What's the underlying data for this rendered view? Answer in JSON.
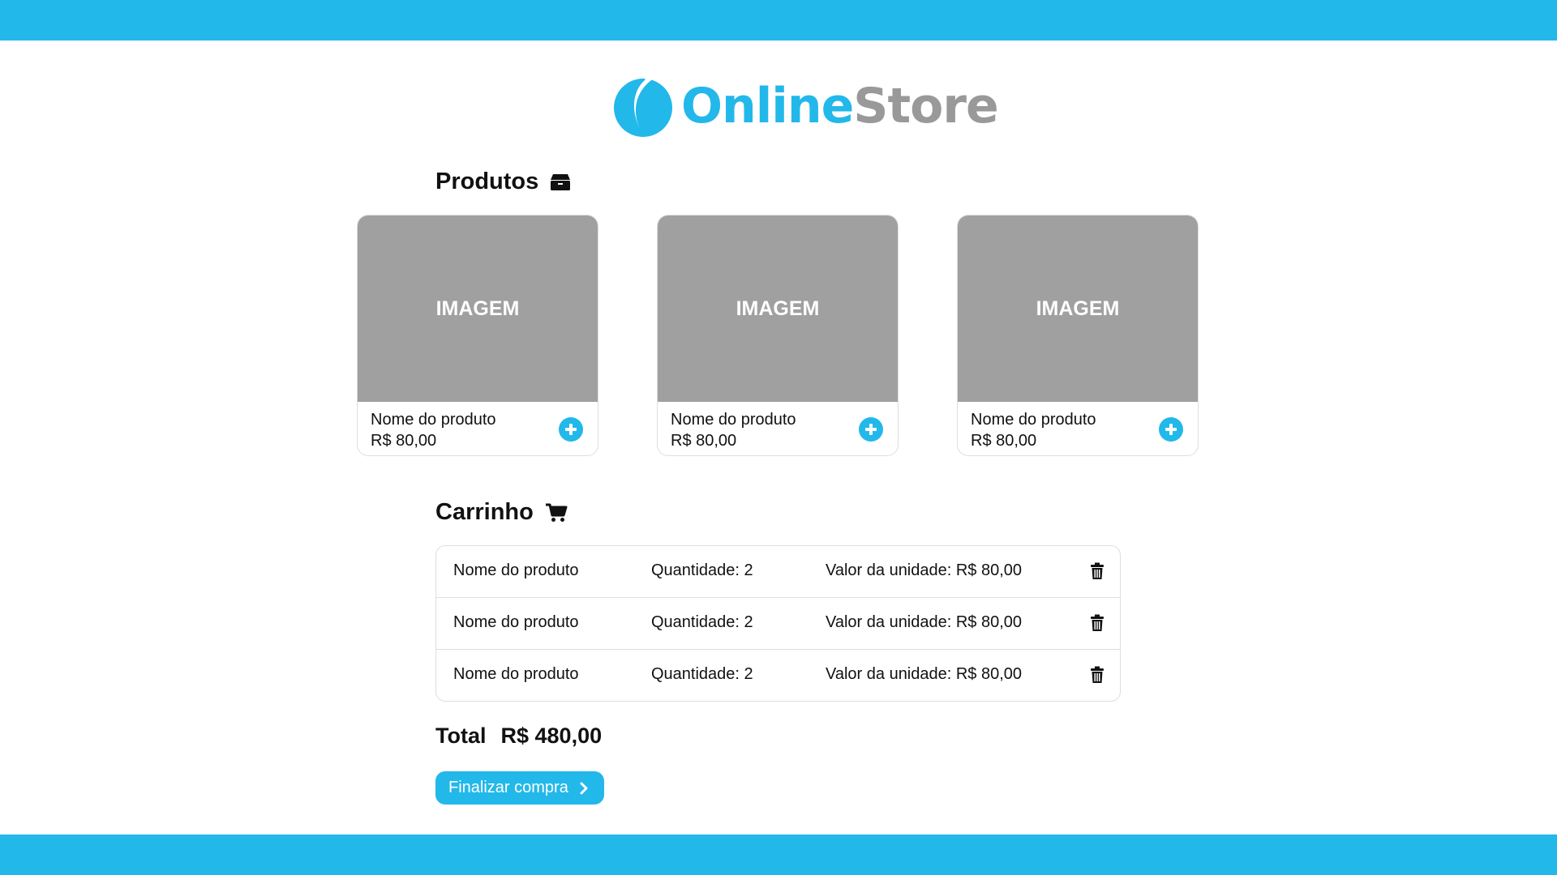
{
  "header": {
    "brand_first": "Online",
    "brand_second": "Store"
  },
  "products": {
    "title": "Produtos",
    "items": [
      {
        "image_label": "IMAGEM",
        "name": "Nome do produto",
        "price": "R$ 80,00"
      },
      {
        "image_label": "IMAGEM",
        "name": "Nome do produto",
        "price": "R$ 80,00"
      },
      {
        "image_label": "IMAGEM",
        "name": "Nome do produto",
        "price": "R$ 80,00"
      }
    ]
  },
  "cart": {
    "title": "Carrinho",
    "rows": [
      {
        "name": "Nome do produto",
        "quantity": "Quantidade: 2",
        "unit_value": "Valor da unidade: R$ 80,00"
      },
      {
        "name": "Nome do produto",
        "quantity": "Quantidade: 2",
        "unit_value": "Valor da unidade: R$ 80,00"
      },
      {
        "name": "Nome do produto",
        "quantity": "Quantidade: 2",
        "unit_value": "Valor da unidade: R$ 80,00"
      }
    ],
    "total_label": "Total",
    "total_value": "R$ 480,00",
    "checkout_label": "Finalizar compra"
  },
  "icons": {
    "products": "box-icon",
    "cart": "cart-icon",
    "add": "plus-circle-icon",
    "remove": "trash-icon",
    "checkout": "chevron-right-icon"
  },
  "colors": {
    "accent": "#22b8ea",
    "placeholder": "#a0a0a0",
    "brand_secondary": "#999999"
  }
}
